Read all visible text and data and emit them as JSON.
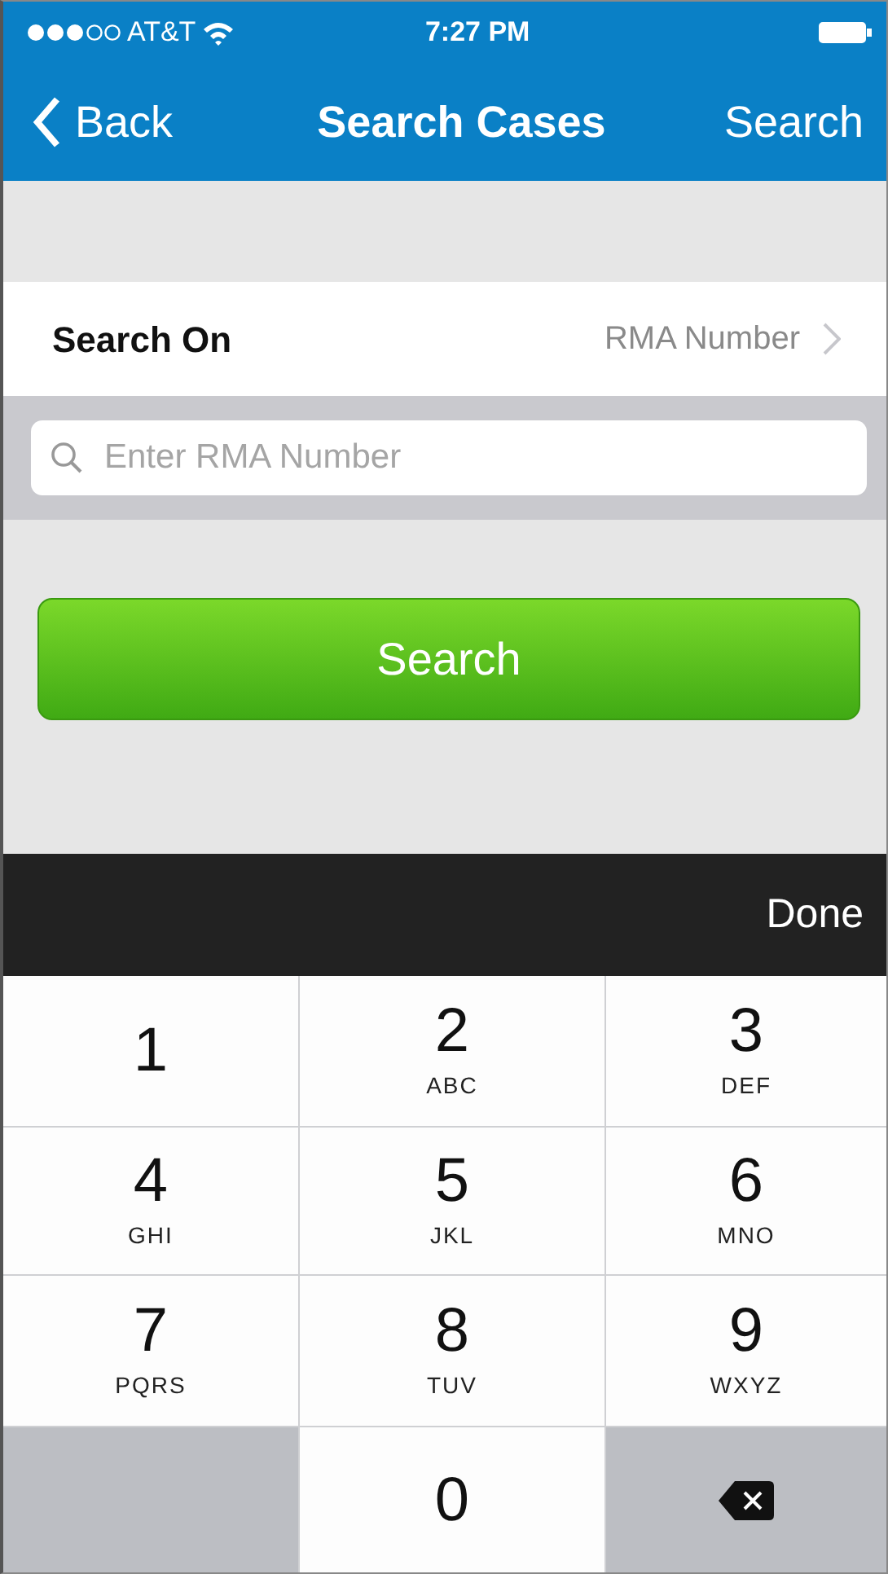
{
  "status_bar": {
    "carrier": "AT&T",
    "time": "7:27 PM"
  },
  "nav_bar": {
    "back": "Back",
    "title": "Search Cases",
    "action": "Search"
  },
  "search_on": {
    "label": "Search On",
    "value": "RMA Number"
  },
  "search_field": {
    "placeholder": "Enter RMA Number"
  },
  "search_button": "Search",
  "keyboard_toolbar": {
    "done": "Done"
  },
  "keypad": [
    {
      "kind": "digit",
      "digit": "1"
    },
    {
      "kind": "digit",
      "digit": "2",
      "letters": "ABC"
    },
    {
      "kind": "digit",
      "digit": "3",
      "letters": "DEF"
    },
    {
      "kind": "digit",
      "digit": "4",
      "letters": "GHI"
    },
    {
      "kind": "digit",
      "digit": "5",
      "letters": "JKL"
    },
    {
      "kind": "digit",
      "digit": "6",
      "letters": "MNO"
    },
    {
      "kind": "digit",
      "digit": "7",
      "letters": "PQRS"
    },
    {
      "kind": "digit",
      "digit": "8",
      "letters": "TUV"
    },
    {
      "kind": "digit",
      "digit": "9",
      "letters": "WXYZ"
    },
    {
      "kind": "blank"
    },
    {
      "kind": "digit",
      "digit": "0"
    },
    {
      "kind": "delete"
    }
  ]
}
